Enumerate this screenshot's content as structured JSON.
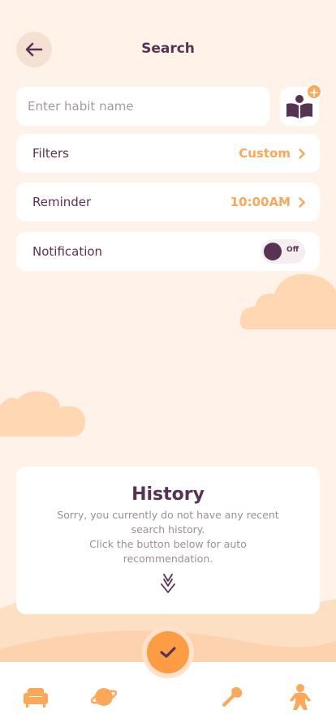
{
  "header": {
    "title": "Search"
  },
  "search": {
    "placeholder": "Enter habit name"
  },
  "rows": {
    "filters": {
      "label": "Filters",
      "value": "Custom"
    },
    "reminder": {
      "label": "Reminder",
      "value": "10:00AM"
    },
    "notification": {
      "label": "Notification",
      "toggle_state": "Off"
    }
  },
  "history": {
    "title": "History",
    "line1": "Sorry, you currently do not have any recent search history.",
    "line2": "Click the button below for auto recommendation."
  },
  "colors": {
    "background": "#FFF3E9",
    "primary_text": "#573353",
    "accent": "#FDA758",
    "fab": "#FC9D45"
  },
  "icons": {
    "back": "arrow-left-icon",
    "add_habit": "book-plus-icon",
    "chevron": "chevron-right-icon",
    "history_arrow": "arrow-down-icon",
    "fab": "checkmark-icon",
    "nav": [
      "sofa-icon",
      "planet-icon",
      "wrench-icon",
      "person-icon"
    ]
  }
}
